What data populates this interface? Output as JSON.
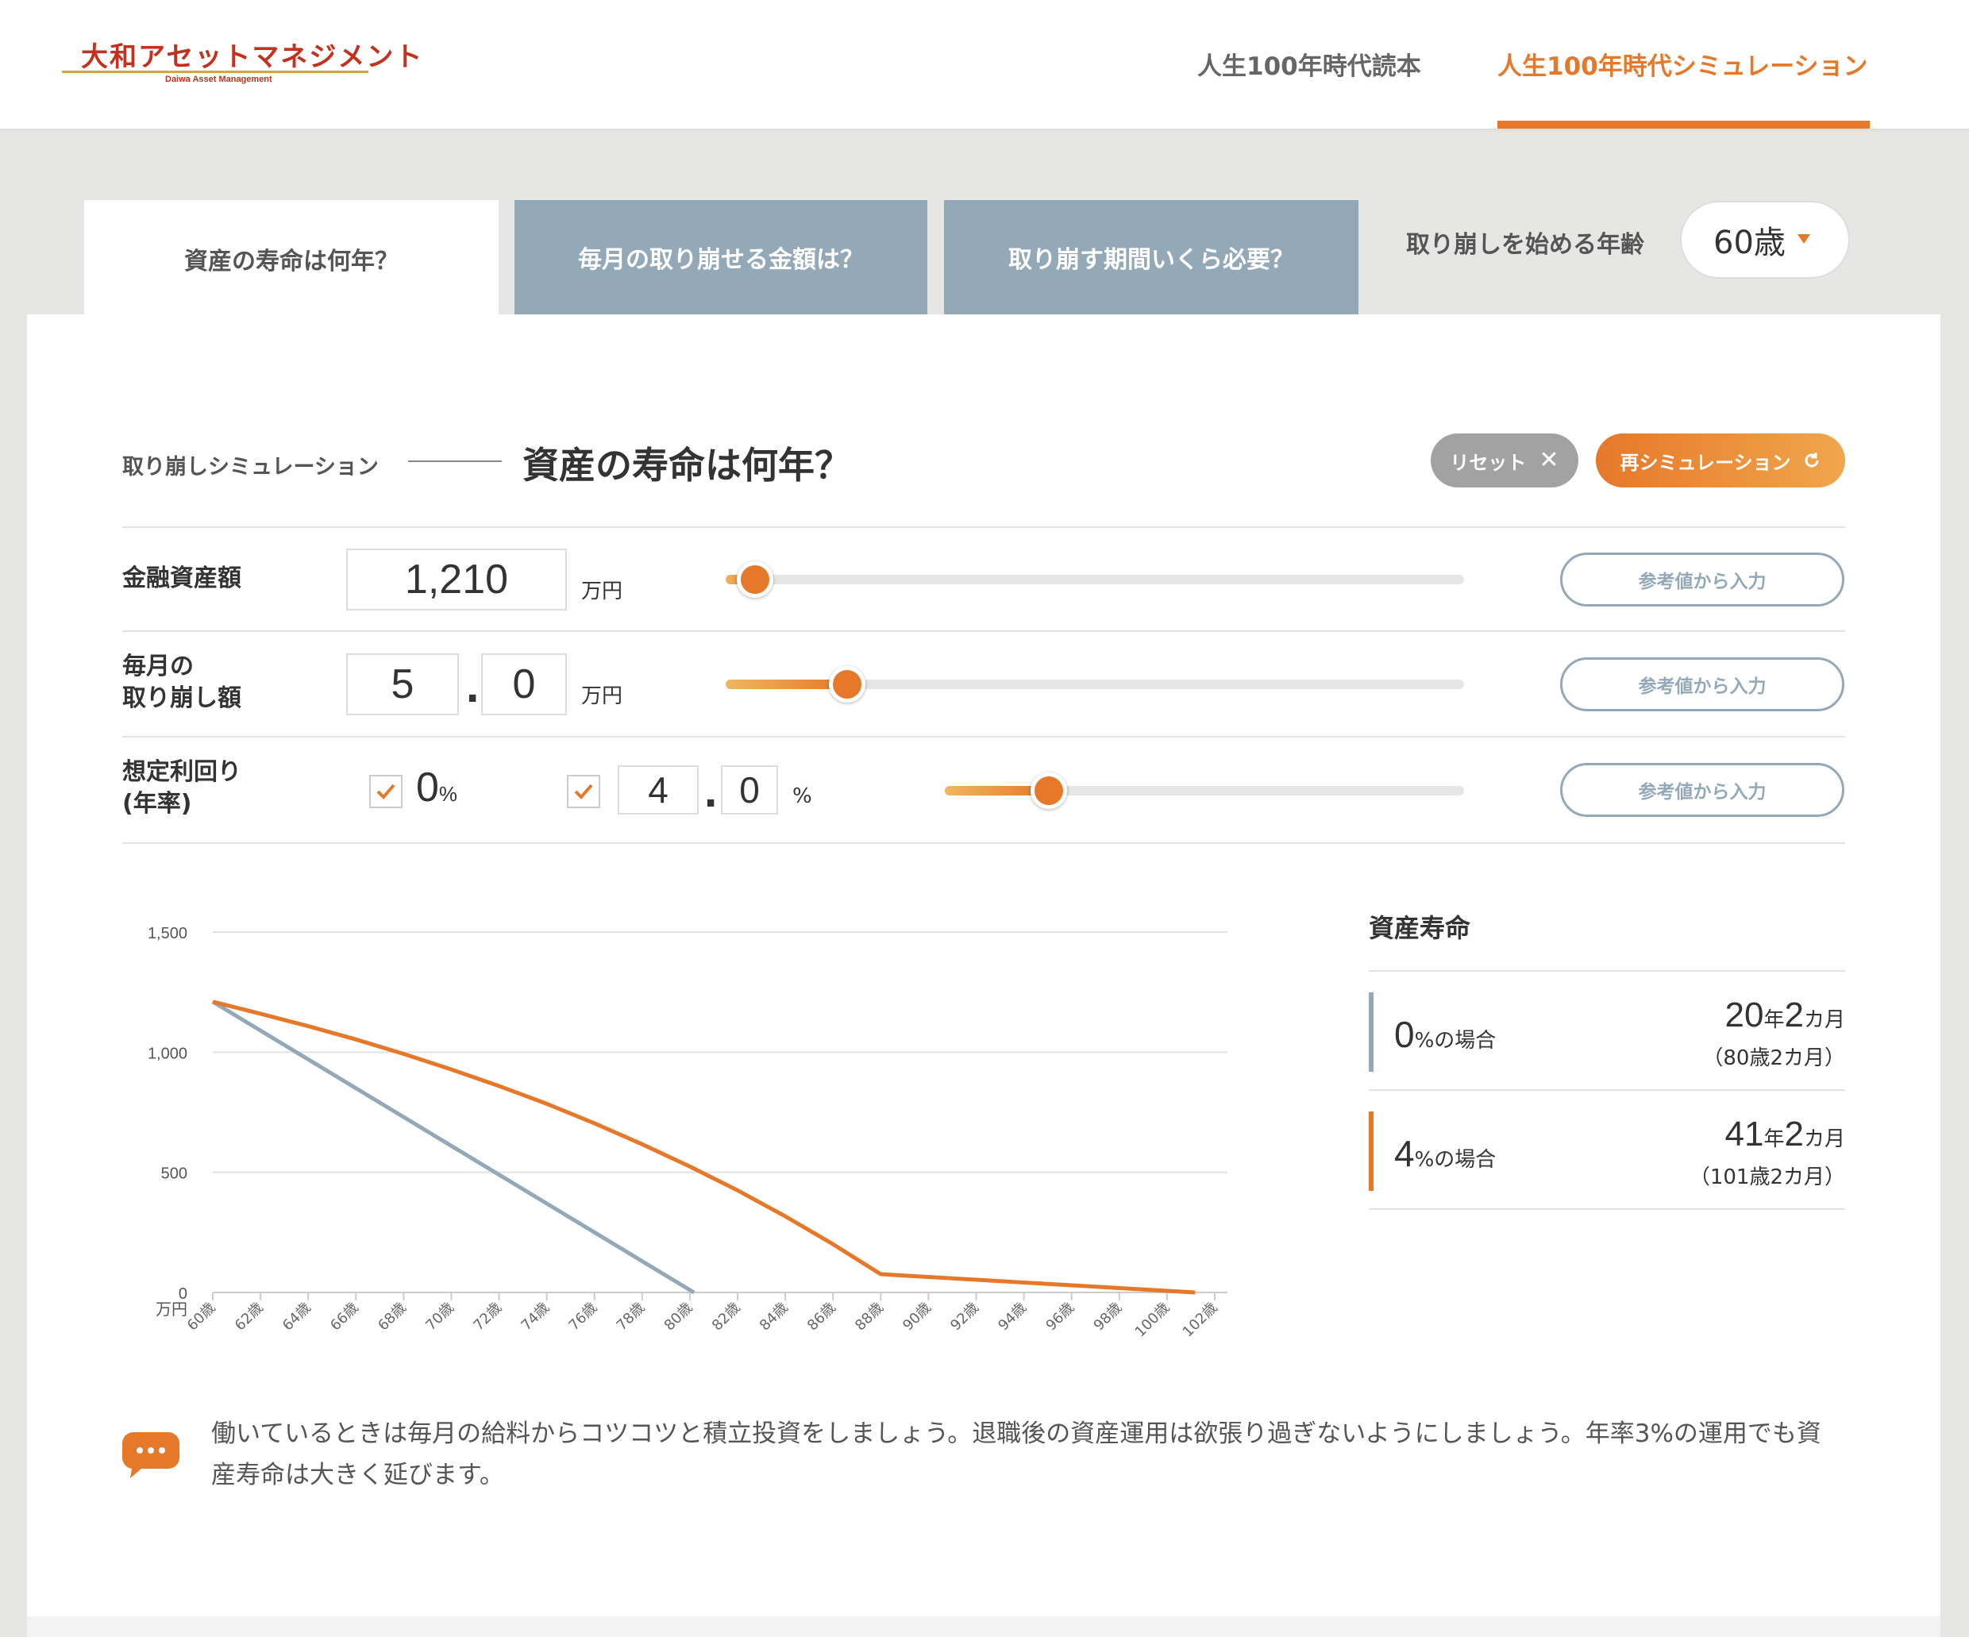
{
  "header": {
    "logo_main": "大和アセットマネジメント",
    "logo_sub": "Daiwa Asset Management",
    "nav": [
      "人生100年時代読本",
      "人生100年時代シミュレーション"
    ]
  },
  "tabs": [
    "資産の寿命は何年？",
    "毎月の取り崩せる金額は？",
    "取り崩す期間いくら必要？"
  ],
  "age_selector": {
    "label": "取り崩しを始める年齢",
    "value": "60歳"
  },
  "section": {
    "sub_label": "取り崩しシミュレーション",
    "title": "資産の寿命は何年？",
    "reset_label": "リセット",
    "resim_label": "再シミュレーション"
  },
  "inputs": {
    "assets": {
      "label": "金融資産額",
      "value": "1,210",
      "unit": "万円",
      "slider_fraction": 0.04,
      "ref_label": "参考値から入力"
    },
    "withdrawal": {
      "label_line1": "毎月の",
      "label_line2": "取り崩し額",
      "int": "5",
      "dec": "0",
      "unit": "万円",
      "slider_fraction": 0.165,
      "ref_label": "参考値から入力"
    },
    "rate": {
      "label_line1": "想定利回り",
      "label_line2": "(年率)",
      "fixed_value": "0",
      "fixed_unit": "%",
      "int": "4",
      "dec": "0",
      "unit": "%",
      "slider_fraction": 0.2,
      "ref_label": "参考値から入力"
    }
  },
  "chart_data": {
    "type": "line",
    "y_ticks": [
      0,
      500,
      1000,
      1500
    ],
    "y_tick_labels": [
      "0",
      "500",
      "1,000",
      "1,500"
    ],
    "y_unit": "万円",
    "ylim": [
      0,
      1500
    ],
    "x_categories": [
      "60歳",
      "62歳",
      "64歳",
      "66歳",
      "68歳",
      "70歳",
      "72歳",
      "74歳",
      "76歳",
      "78歳",
      "80歳",
      "82歳",
      "84歳",
      "86歳",
      "88歳",
      "90歳",
      "92歳",
      "94歳",
      "96歳",
      "98歳",
      "100歳",
      "102歳"
    ],
    "xlim": [
      60,
      103
    ],
    "grid": true,
    "colors": {
      "zero": "#94a9b7",
      "four": "#e6782a"
    },
    "series": [
      {
        "name": "0%",
        "points": [
          [
            60,
            1210
          ],
          [
            80.17,
            0
          ]
        ]
      },
      {
        "name": "4%",
        "points": [
          [
            60,
            1210
          ],
          [
            62,
            1160
          ],
          [
            64,
            1108
          ],
          [
            66,
            1053
          ],
          [
            68,
            993
          ],
          [
            70,
            928
          ],
          [
            72,
            859
          ],
          [
            74,
            785
          ],
          [
            76,
            704
          ],
          [
            78,
            617
          ],
          [
            80,
            524
          ],
          [
            82,
            425
          ],
          [
            84,
            317
          ],
          [
            86,
            201
          ],
          [
            88,
            76
          ],
          [
            101.17,
            0
          ]
        ]
      }
    ]
  },
  "results": {
    "title": "資産寿命",
    "rows": [
      {
        "rate": "0",
        "rate_suffix": "%の場合",
        "years": "20",
        "months": "2",
        "age_text": "（80歳2カ月）",
        "color": "#94a9b7"
      },
      {
        "rate": "4",
        "rate_suffix": "%の場合",
        "years": "41",
        "months": "2",
        "age_text": "（101歳2カ月）",
        "color": "#e6782a"
      }
    ],
    "year_unit": "年",
    "month_unit": "カ月"
  },
  "comment": "働いているときは毎月の給料からコツコツと積立投資をしましょう。退職後の資産運用は欲張り過ぎないようにしましょう。年率3%の運用でも資産寿命は大きく延びます。"
}
